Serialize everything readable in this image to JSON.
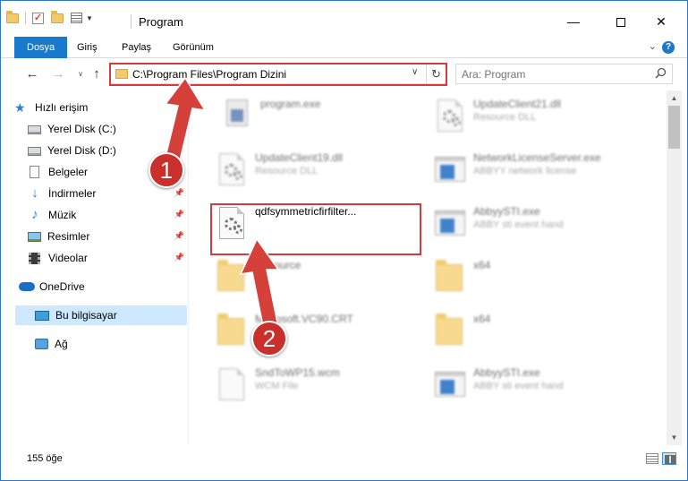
{
  "window": {
    "title": "Program",
    "controls": {
      "minimize": "—",
      "maximize": "",
      "close": "✕"
    }
  },
  "ribbon": {
    "tabs": [
      "Dosya",
      "Giriş",
      "Paylaş",
      "Görünüm"
    ],
    "help": "?"
  },
  "address_bar": {
    "path": "C:\\Program Files\\Program Dizini",
    "search_placeholder": "Ara: Program"
  },
  "sidebar": {
    "items": [
      {
        "label": "Hızlı erişim",
        "icon": "star-icon",
        "pinned": false
      },
      {
        "label": "Yerel Disk (C:)",
        "icon": "drive-icon",
        "pinned": true
      },
      {
        "label": "Yerel Disk (D:)",
        "icon": "drive-icon",
        "pinned": true
      },
      {
        "label": "Belgeler",
        "icon": "documents-icon",
        "pinned": true
      },
      {
        "label": "İndirmeler",
        "icon": "downloads-icon",
        "pinned": true
      },
      {
        "label": "Müzik",
        "icon": "music-icon",
        "pinned": true
      },
      {
        "label": "Resimler",
        "icon": "pictures-icon",
        "pinned": true
      },
      {
        "label": "Videolar",
        "icon": "videos-icon",
        "pinned": true
      },
      {
        "label": "OneDrive",
        "icon": "onedrive-icon",
        "pinned": false
      },
      {
        "label": "Bu bilgisayar",
        "icon": "computer-icon",
        "pinned": false,
        "selected": true
      },
      {
        "label": "Ağ",
        "icon": "network-icon",
        "pinned": false
      }
    ]
  },
  "files": [
    {
      "name": "program.exe",
      "type": "",
      "icon": "program-icon"
    },
    {
      "name": "UpdateClient21.dll",
      "type": "Resource DLL",
      "icon": "dll-icon"
    },
    {
      "name": "UpdateClient19.dll",
      "type": "Resource DLL",
      "icon": "dll-icon"
    },
    {
      "name": "NetworkLicenseServer.exe",
      "type": "ABBYY network license",
      "icon": "exe-icon"
    },
    {
      "name": "qdfsymmetricfirfilter...",
      "type": "",
      "icon": "dll-icon"
    },
    {
      "name": "AbbyySTI.exe",
      "type": "ABBY sti event hand",
      "icon": "exe-icon"
    },
    {
      "name": "Resource",
      "type": "",
      "icon": "folder-icon"
    },
    {
      "name": "x64",
      "type": "",
      "icon": "folder-icon"
    },
    {
      "name": "Microsoft.VC90.CRT",
      "type": "",
      "icon": "folder-icon"
    },
    {
      "name": "x64",
      "type": "",
      "icon": "folder-icon"
    },
    {
      "name": "SndToWP15.wcm",
      "type": "WCM File",
      "icon": "file-icon"
    },
    {
      "name": "AbbyySTI.exe",
      "type": "ABBY sti event hand",
      "icon": "exe-icon"
    }
  ],
  "status_bar": {
    "item_count": "155 öğe"
  },
  "annotations": {
    "step1": "1",
    "step2": "2"
  },
  "colors": {
    "accent": "#1979ca",
    "highlight": "#d63a3a",
    "badge": "#c9302c",
    "selection": "#cde8ff"
  }
}
